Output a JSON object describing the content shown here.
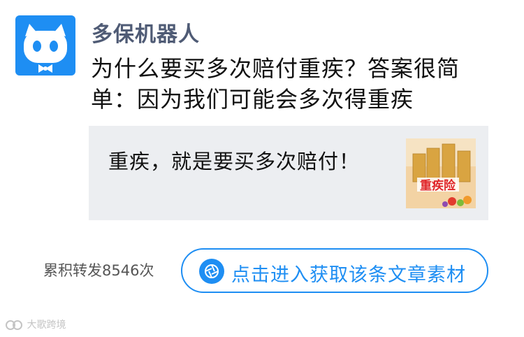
{
  "post": {
    "author": "多保机器人",
    "headline": "为什么要买多次赔付重疾？答案很简单：因为我们可能会多次得重疾"
  },
  "card": {
    "title": "重疾，就是要买多次赔付！",
    "thumbnail_text": "重疾险"
  },
  "footer": {
    "repost_count": "累积转发8546次",
    "cta_label": "点击进入获取该条文章素材"
  },
  "watermark": "大歌跨境",
  "colors": {
    "accent": "#1e8ef3",
    "author": "#4f5b75",
    "card_bg": "#eceef1"
  },
  "icons": {
    "avatar": "robot-face-icon",
    "cta": "camera-aperture-icon",
    "watermark": "watermark-logo-icon"
  }
}
